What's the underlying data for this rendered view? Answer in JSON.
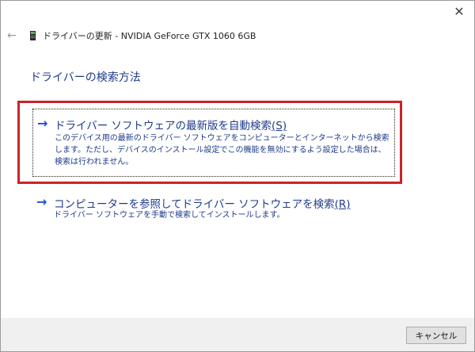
{
  "window": {
    "close_glyph": "✕"
  },
  "header": {
    "back_glyph": "←",
    "title": "ドライバーの更新 - NVIDIA GeForce GTX 1060 6GB"
  },
  "main": {
    "title": "ドライバーの検索方法",
    "options": [
      {
        "arrow": "→",
        "label": "ドライバー ソフトウェアの最新版を自動検索",
        "hotkey": "(S)",
        "description": "このデバイス用の最新のドライバー ソフトウェアをコンピューターとインターネットから検索します。ただし、デバイスのインストール設定でこの機能を無効にするよう設定した場合は、検索は行われません。"
      },
      {
        "arrow": "→",
        "label": "コンピューターを参照してドライバー ソフトウェアを検索",
        "hotkey": "(R)",
        "description": "ドライバー ソフトウェアを手動で検索してインストールします。"
      }
    ]
  },
  "footer": {
    "cancel_label": "キャンセル"
  },
  "colors": {
    "link": "#1e3a8a",
    "arrow": "#1d4ed8",
    "highlight_frame": "#cc2229"
  },
  "icons": {
    "close": "close-icon",
    "back": "back-arrow-icon",
    "device": "graphics-card-icon",
    "option_arrow": "arrow-right-icon"
  }
}
